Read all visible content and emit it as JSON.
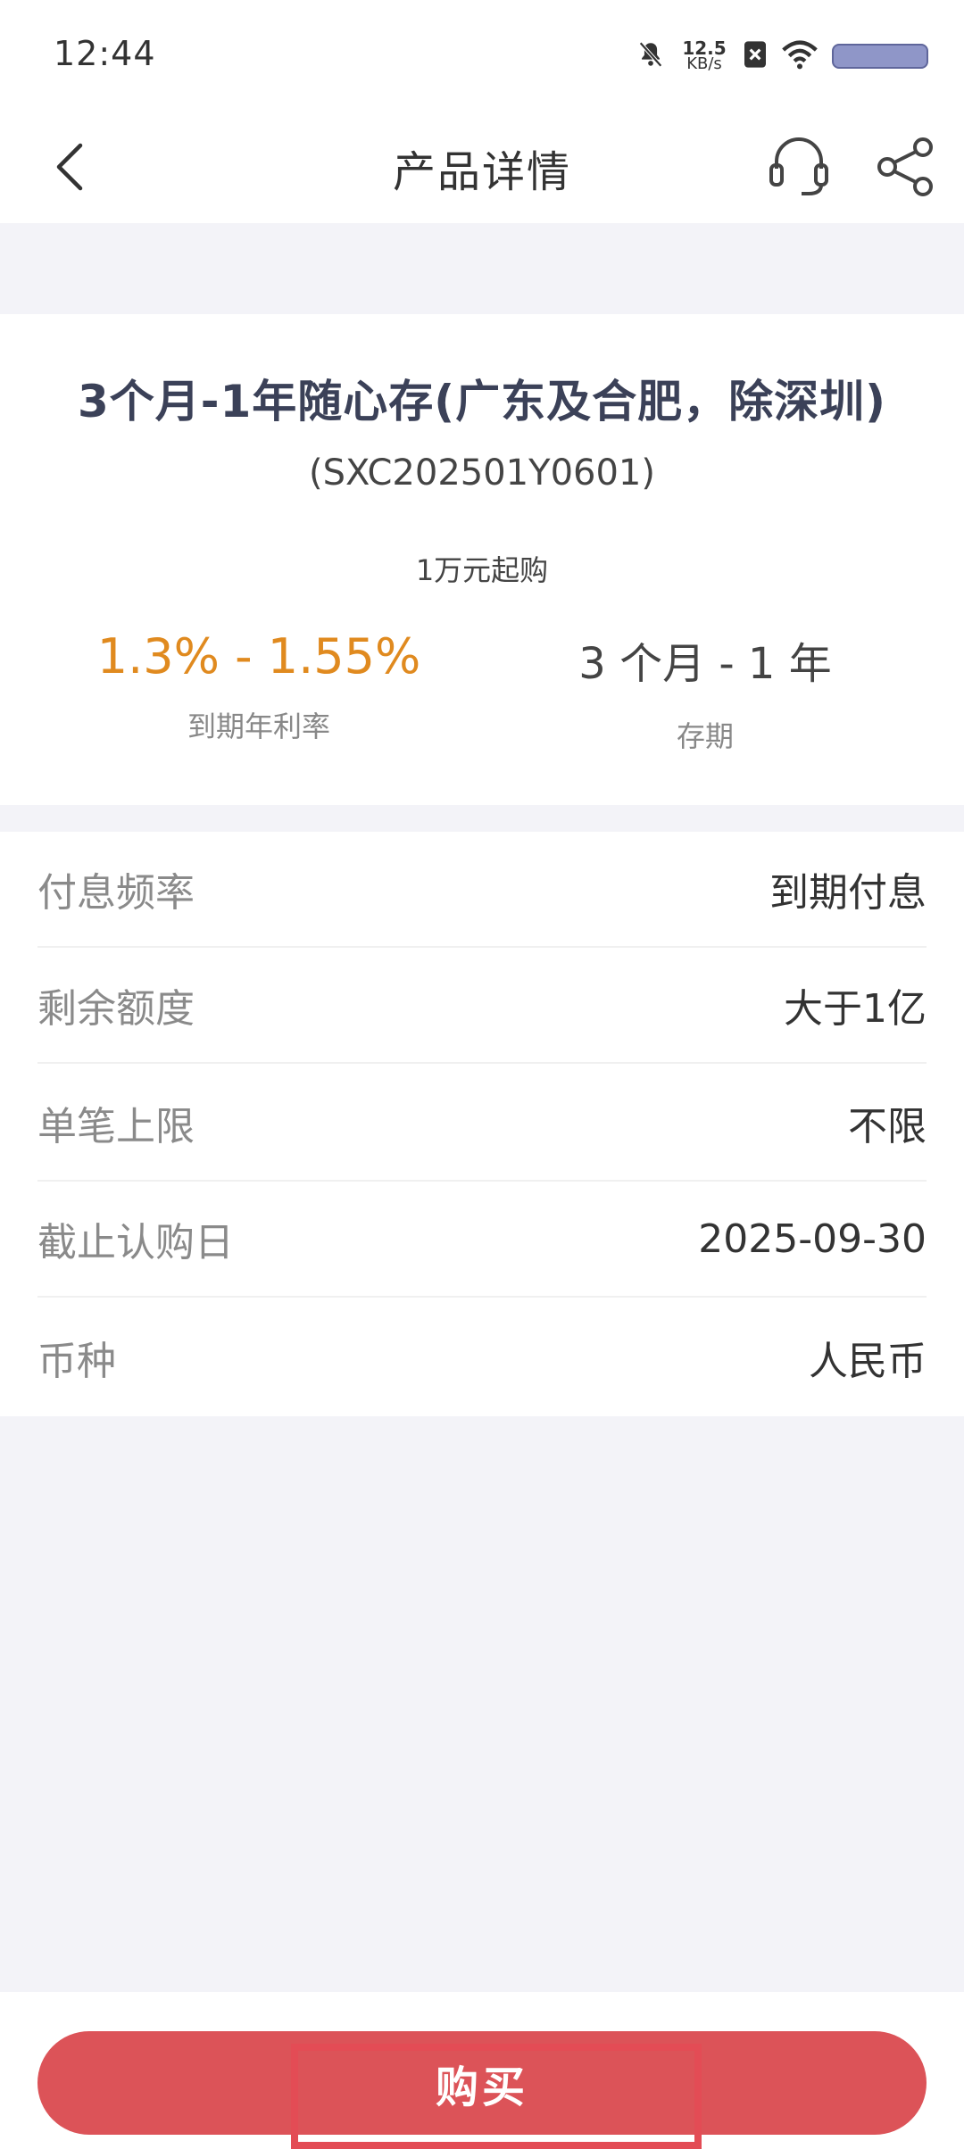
{
  "status_bar": {
    "time": "12:44",
    "net_speed_value": "12.5",
    "net_speed_unit": "KB/s",
    "icons": [
      "bell-muted-icon",
      "no-sim-icon",
      "wifi-icon",
      "battery-icon"
    ],
    "battery_color": "#8f96c8"
  },
  "nav": {
    "title": "产品详情",
    "icons": [
      "back-arrow-icon",
      "headset-icon",
      "share-icon"
    ]
  },
  "product": {
    "name": "3个月-1年随心存(广东及合肥，除深圳)",
    "code": "(SXC202501Y0601)",
    "min_purchase": "1万元起购",
    "rate": "1.3% - 1.55%",
    "rate_label": "到期年利率",
    "term": "3 个月 - 1 年",
    "term_label": "存期",
    "rate_color": "#e08a1f"
  },
  "details": [
    {
      "label": "付息频率",
      "value": "到期付息"
    },
    {
      "label": "剩余额度",
      "value": "大于1亿"
    },
    {
      "label": "单笔上限",
      "value": "不限"
    },
    {
      "label": "截止认购日",
      "value": "2025-09-30"
    },
    {
      "label": "币种",
      "value": "人民币"
    }
  ],
  "footer": {
    "buy_label": "购买",
    "buy_color": "#dc5358"
  }
}
